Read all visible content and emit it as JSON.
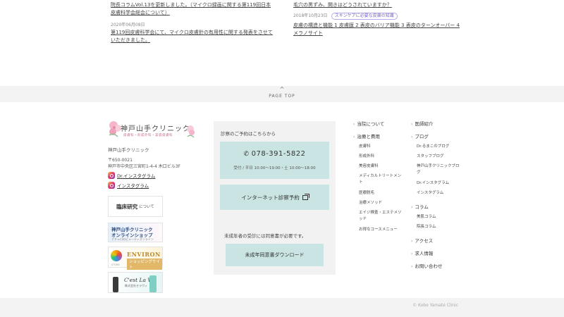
{
  "news": {
    "left": {
      "item1_title": "院長コラムVol.13を更新しました。（マイクロ録画に関する第119回日本皮膚科学会総会について）",
      "item2_date": "2020年06月08日",
      "item2_title": "第119回皮膚科学会にて、マイクロ皮膚針の有用性に関する発表をさせていただきました。"
    },
    "right": {
      "item1_title": "毛穴の黒ずみ、開きはどうされていますか？",
      "item2_date": "2018年10月23日",
      "item2_tag": "スキンケアに必要な皮膚の知識",
      "item2_title": "皮膚の構造と機能 1 皮膚膜 2 表皮のバリア機能 3 表皮のターンオーバー 4 メラノサイト"
    }
  },
  "pagetop": {
    "chevron": "^",
    "label": "PAGE TOP"
  },
  "brand": {
    "name": "神戸山手クリニック",
    "sub": "皮膚科・形成外科・美容皮膚科"
  },
  "clinic": {
    "name": "神戸山手クリニック",
    "postal": "〒650-0021",
    "address": "神戸市中央区三宮町1-4-4 木口ビル3F"
  },
  "instagram": [
    {
      "label": "Dr.インスタグラム"
    },
    {
      "label": "インスタグラム"
    }
  ],
  "banners": {
    "research_big": "臨床研究",
    "research_small": "について",
    "shop_line1": "神戸山手クリニック",
    "shop_line2": "オンラインショップ",
    "shop_line3": "ナチュロのビューティオンライン",
    "environ_title": "ENVIRON",
    "environ_sub": "ショッピングサイト",
    "environ_store": "STORE",
    "cestlavie_title": "C'est La Vie",
    "cestlavie_sub": "株式会社セラヴィ"
  },
  "reserve": {
    "title": "診察のご予約はこちらから",
    "phone_icon": "✆",
    "phone": "078-391-5822",
    "hours": "受付 / 平日 10:00〜19:00・土 10:00〜18:00",
    "web_label": "インターネット診察予約",
    "minor_note": "未成年者の受診には同意書が必要です。",
    "minor_button": "未成年同意書ダウンロード"
  },
  "nav": {
    "arrow": "›",
    "col1": {
      "about": "当院について",
      "treatment": "治療と費用",
      "sub": [
        "皮膚科",
        "形成外科",
        "美容皮膚科",
        "メディカルトリートメント",
        "医療脱毛",
        "治療メソッド",
        "エイジ検査・エステメソッド",
        "お得なコースメニュー"
      ]
    },
    "col2": {
      "doctor": "医師紹介",
      "blog": "ブログ",
      "blog_sub": [
        "Dr.るまこのブログ",
        "スタッフブログ",
        "神戸山手クリニックブログ",
        "Dr.インスタグラム",
        "インスタグラム"
      ],
      "column": "コラム",
      "column_sub": [
        "美肌コラム",
        "院長コラム"
      ],
      "access": "アクセス",
      "recruit": "求人情報",
      "contact": "お問い合わせ"
    }
  },
  "copyright": "© Kobe Yamate Clinic"
}
